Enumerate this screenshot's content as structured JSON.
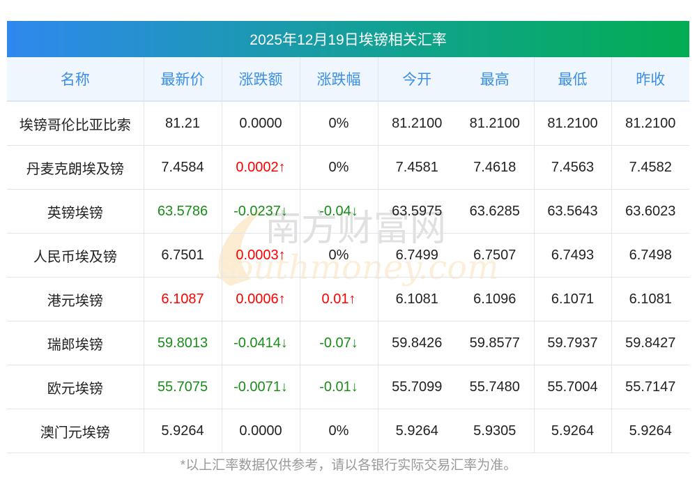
{
  "title": "2025年12月19日埃镑相关汇率",
  "columns": [
    "名称",
    "最新价",
    "涨跌额",
    "涨跌幅",
    "今开",
    "最高",
    "最低",
    "昨收"
  ],
  "rows": [
    {
      "name": "埃镑哥伦比亚比索",
      "latest": "81.21",
      "change": "0.0000",
      "pct": "0%",
      "open": "81.2100",
      "high": "81.2100",
      "low": "81.2100",
      "prev": "81.2100",
      "latest_dir": "",
      "change_dir": "",
      "pct_dir": ""
    },
    {
      "name": "丹麦克朗埃及镑",
      "latest": "7.4584",
      "change": "0.0002↑",
      "pct": "0%",
      "open": "7.4581",
      "high": "7.4618",
      "low": "7.4563",
      "prev": "7.4582",
      "latest_dir": "",
      "change_dir": "up",
      "pct_dir": ""
    },
    {
      "name": "英镑埃镑",
      "latest": "63.5786",
      "change": "-0.0237↓",
      "pct": "-0.04↓",
      "open": "63.5975",
      "high": "63.6285",
      "low": "63.5643",
      "prev": "63.6023",
      "latest_dir": "down",
      "change_dir": "down",
      "pct_dir": "down"
    },
    {
      "name": "人民币埃及镑",
      "latest": "6.7501",
      "change": "0.0003↑",
      "pct": "0%",
      "open": "6.7499",
      "high": "6.7507",
      "low": "6.7493",
      "prev": "6.7498",
      "latest_dir": "",
      "change_dir": "up",
      "pct_dir": ""
    },
    {
      "name": "港元埃镑",
      "latest": "6.1087",
      "change": "0.0006↑",
      "pct": "0.01↑",
      "open": "6.1081",
      "high": "6.1096",
      "low": "6.1071",
      "prev": "6.1081",
      "latest_dir": "up",
      "change_dir": "up",
      "pct_dir": "up"
    },
    {
      "name": "瑞郎埃镑",
      "latest": "59.8013",
      "change": "-0.0414↓",
      "pct": "-0.07↓",
      "open": "59.8426",
      "high": "59.8577",
      "low": "59.7937",
      "prev": "59.8427",
      "latest_dir": "down",
      "change_dir": "down",
      "pct_dir": "down"
    },
    {
      "name": "欧元埃镑",
      "latest": "55.7075",
      "change": "-0.0071↓",
      "pct": "-0.01↓",
      "open": "55.7099",
      "high": "55.7480",
      "low": "55.7004",
      "prev": "55.7147",
      "latest_dir": "down",
      "change_dir": "down",
      "pct_dir": "down"
    },
    {
      "name": "澳门元埃镑",
      "latest": "5.9264",
      "change": "0.0000",
      "pct": "0%",
      "open": "5.9264",
      "high": "5.9305",
      "low": "5.9264",
      "prev": "5.9264",
      "latest_dir": "",
      "change_dir": "",
      "pct_dir": ""
    }
  ],
  "footer": "*以上汇率数据仅供参考，请以各银行实际交易汇率为准。",
  "watermark": {
    "cn": "南方财富网",
    "en": "southmoney.com"
  },
  "colors": {
    "up": "#ff0000",
    "down": "#1a8c1a",
    "header_text": "#3a8ee6"
  }
}
